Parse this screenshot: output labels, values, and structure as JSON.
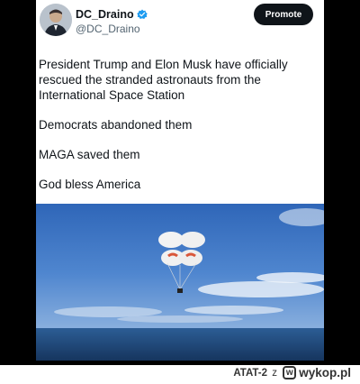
{
  "post": {
    "display_name": "DC_Draino",
    "handle": "@DC_Draino",
    "verified_icon": "verified-badge-icon",
    "promote_label": "Promote",
    "lines": [
      "President Trump and Elon Musk have officially",
      "rescued the stranded astronauts from the",
      "International Space Station",
      "",
      "Democrats abandoned them",
      "",
      "MAGA saved them",
      "",
      "God bless America"
    ],
    "media_icon": "capsule-parachute-image"
  },
  "footer": {
    "user": "ATAT-2",
    "separator": "z",
    "site": "wykop.pl",
    "logo_letter": "w"
  },
  "colors": {
    "text": "#0f1419",
    "secondary": "#536471",
    "verified": "#1d9bf0",
    "promote_bg": "#0f1419",
    "frame": "#000000"
  }
}
